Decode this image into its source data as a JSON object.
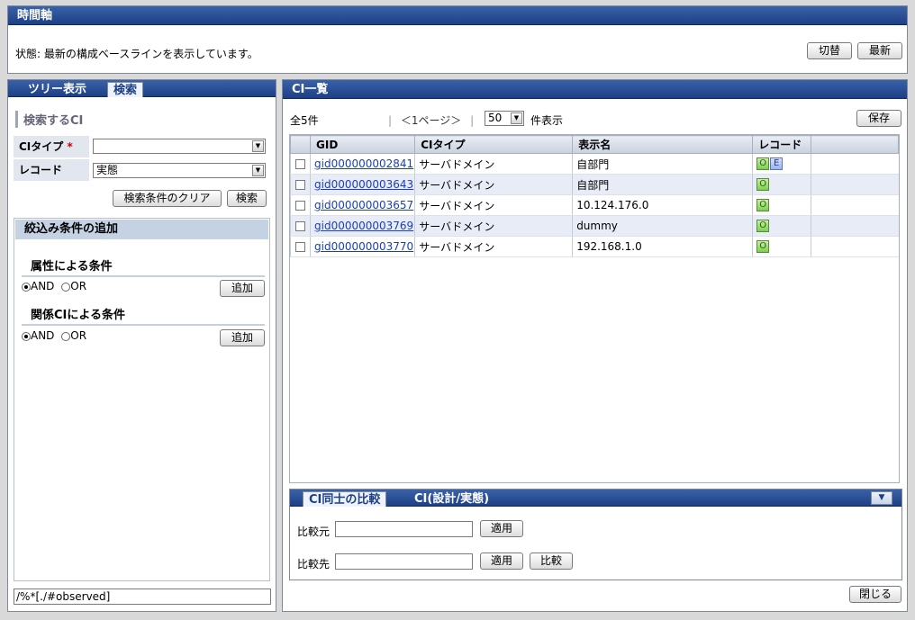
{
  "timeline": {
    "title": "時間軸",
    "status": "状態: 最新の構成ベースラインを表示しています。",
    "switch_label": "切替",
    "latest_label": "最新"
  },
  "left": {
    "tabs": [
      {
        "label": "ツリー表示"
      },
      {
        "label": "検索"
      }
    ],
    "section_title": "検索するCI",
    "ci_type_label": "CIタイプ",
    "required_mark": "*",
    "ci_type_value": "",
    "record_label": "レコード",
    "record_value": "実態",
    "clear_label": "検索条件のクリア",
    "search_label": "検索",
    "filter": {
      "title": "絞込み条件の追加",
      "attr_title": "属性による条件",
      "rel_title": "関係CIによる条件",
      "and_label": "AND",
      "or_label": "OR",
      "add_label": "追加"
    },
    "xpath": "/%*[./#observed]"
  },
  "ci_list": {
    "title": "CI一覧",
    "total": "全5件",
    "pager": "＜1ページ＞",
    "sep": "|",
    "page_size": "50",
    "page_size_suffix": "件表示",
    "save_label": "保存",
    "columns": [
      "GID",
      "CIタイプ",
      "表示名",
      "レコード"
    ],
    "rows": [
      {
        "gid": "gid000000002841",
        "type": "サーバドメイン",
        "name": "自部門",
        "records": [
          "O",
          "E"
        ]
      },
      {
        "gid": "gid000000003643",
        "type": "サーバドメイン",
        "name": "自部門",
        "records": [
          "O"
        ]
      },
      {
        "gid": "gid000000003657",
        "type": "サーバドメイン",
        "name": "10.124.176.0",
        "records": [
          "O"
        ]
      },
      {
        "gid": "gid000000003769",
        "type": "サーバドメイン",
        "name": "dummy",
        "records": [
          "O"
        ]
      },
      {
        "gid": "gid000000003770",
        "type": "サーバドメイン",
        "name": "192.168.1.0",
        "records": [
          "O"
        ]
      }
    ]
  },
  "compare": {
    "tabs": [
      {
        "label": "CI同士の比較"
      },
      {
        "label": "CI(設計/実態)"
      }
    ],
    "source_label": "比較元",
    "target_label": "比較先",
    "apply_label": "適用",
    "compare_label": "比較"
  },
  "close_label": "閉じる"
}
